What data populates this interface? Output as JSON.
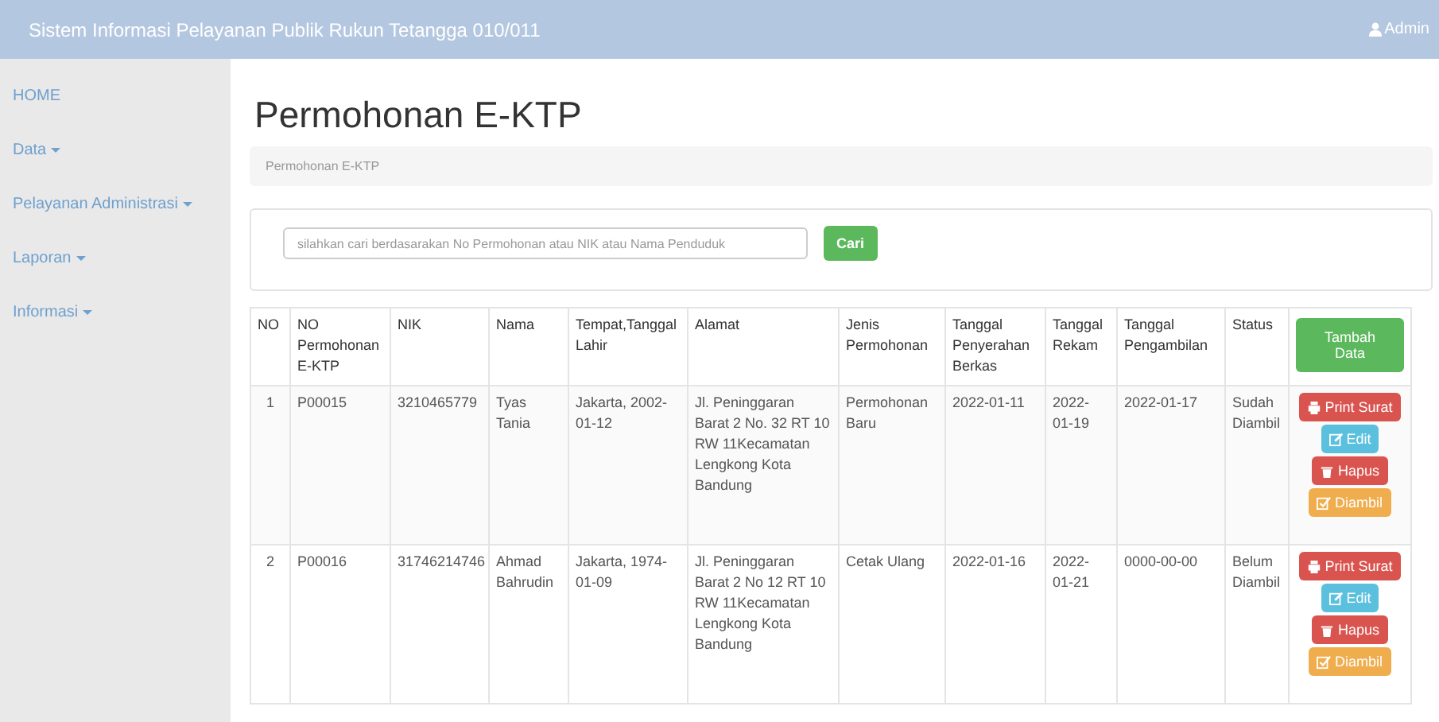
{
  "top_bar": {
    "title": "Sistem Informasi Pelayanan Publik Rukun Tetangga 010/011",
    "user": "Admin"
  },
  "sidebar": {
    "items": [
      {
        "label": "HOME",
        "dropdown": false
      },
      {
        "label": "Data",
        "dropdown": true
      },
      {
        "label": "Pelayanan Administrasi",
        "dropdown": true
      },
      {
        "label": "Laporan",
        "dropdown": true
      },
      {
        "label": "Informasi",
        "dropdown": true
      }
    ]
  },
  "page": {
    "title": "Permohonan E-KTP",
    "breadcrumb": "Permohonan E-KTP"
  },
  "search": {
    "placeholder": "silahkan cari berdasarakan No Permohonan atau NIK atau Nama Penduduk",
    "button": "Cari"
  },
  "table": {
    "columns": [
      "NO",
      "NO Permohonan E-KTP",
      "NIK",
      "Nama",
      "Tempat,Tanggal Lahir",
      "Alamat",
      "Jenis Permohonan",
      "Tanggal Penyerahan Berkas",
      "Tanggal Rekam",
      "Tanggal Pengambilan",
      "Status"
    ],
    "add_button": "Tambah Data",
    "rows": [
      {
        "cells": [
          "1",
          "P00015",
          "3210465779",
          "Tyas Tania",
          "Jakarta, 2002-01-12",
          "Jl. Peninggaran Barat 2 No. 32 RT 10 RW 11Kecamatan Lengkong Kota Bandung",
          "Permohonan Baru",
          "2022-01-11",
          "2022-01-19",
          "2022-01-17",
          "Sudah Diambil"
        ],
        "actions": [
          {
            "kind": "print",
            "label": "Print Surat"
          },
          {
            "kind": "edit",
            "label": "Edit"
          },
          {
            "kind": "delete",
            "label": "Hapus"
          },
          {
            "kind": "taken",
            "label": "Diambil"
          }
        ]
      },
      {
        "cells": [
          "2",
          "P00016",
          "31746214746",
          "Ahmad Bahrudin",
          "Jakarta, 1974-01-09",
          "Jl. Peninggaran Barat 2 No 12 RT 10 RW 11Kecamatan Lengkong Kota Bandung",
          "Cetak Ulang",
          "2022-01-16",
          "2022-01-21",
          "0000-00-00",
          "Belum Diambil"
        ],
        "actions": [
          {
            "kind": "print",
            "label": "Print Surat"
          },
          {
            "kind": "edit",
            "label": "Edit"
          },
          {
            "kind": "delete",
            "label": "Hapus"
          },
          {
            "kind": "taken",
            "label": "Diambil"
          }
        ]
      }
    ]
  }
}
